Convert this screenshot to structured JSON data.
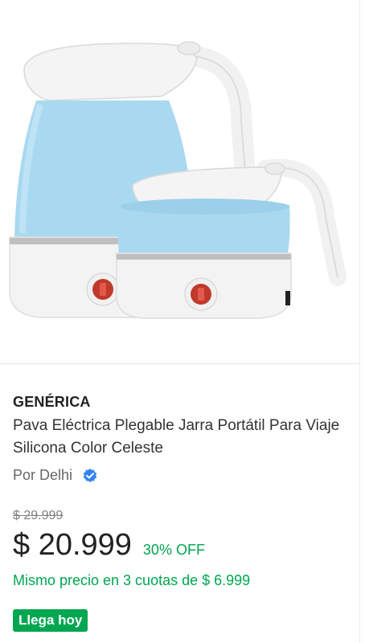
{
  "product": {
    "brand": "GENÉRICA",
    "title": "Pava Eléctrica Plegable Jarra Portátil Para Viaje Silicona Color Celeste",
    "seller": "Por Delhi",
    "original_price": "$ 29.999",
    "price": "$ 20.999",
    "discount": "30% OFF",
    "installments": "Mismo precio en 3 cuotas de $ 6.999",
    "shipping_badge": "Llega hoy"
  },
  "colors": {
    "accent_green": "#00a650",
    "verified_blue": "#3483fa",
    "kettle_blue": "#a8d8f0"
  },
  "icons": {
    "verified": "verified-check-icon"
  }
}
